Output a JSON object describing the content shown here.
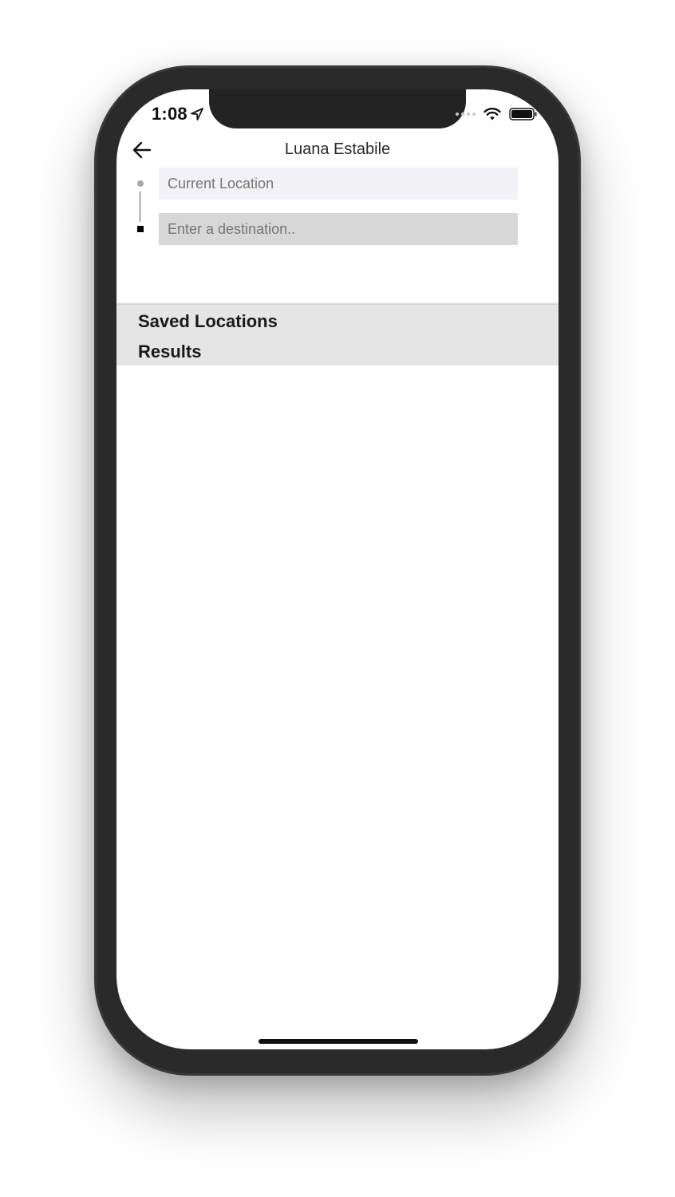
{
  "status_bar": {
    "time": "1:08",
    "icons": [
      "location-arrow-icon",
      "signal-dots-icon",
      "wifi-icon",
      "battery-icon"
    ]
  },
  "nav": {
    "back_icon": "arrow-left-icon",
    "title": "Luana Estabile"
  },
  "route": {
    "origin_placeholder": "Current Location",
    "destination_placeholder": "Enter a destination.."
  },
  "sections": {
    "saved_locations": "Saved Locations",
    "results": "Results"
  },
  "colors": {
    "frame": "#2b2a2a",
    "origin_field_bg": "#f2f2f6",
    "destination_field_bg": "#d7d7d7",
    "section_header_bg": "#e5e5e5"
  }
}
